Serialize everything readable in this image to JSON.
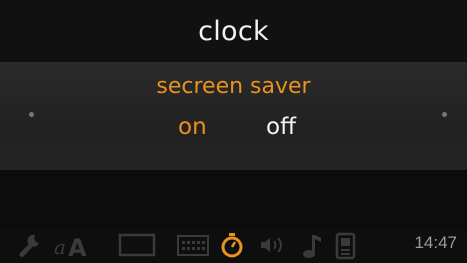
{
  "screen": {
    "title": "clock"
  },
  "setting": {
    "label": "secreen saver",
    "options": [
      "on",
      "off"
    ],
    "selected": "on"
  },
  "toolbar": {
    "icons": [
      "wrench-icon",
      "text-size-icon",
      "display-icon",
      "keyboard-icon",
      "timer-icon",
      "volume-icon",
      "music-note-icon",
      "phone-icon"
    ],
    "active_icon": "timer-icon"
  },
  "status": {
    "time": "14:47"
  },
  "colors": {
    "accent": "#e8931d",
    "text": "#f5f5f5",
    "inactive": "#3a3a3a"
  }
}
